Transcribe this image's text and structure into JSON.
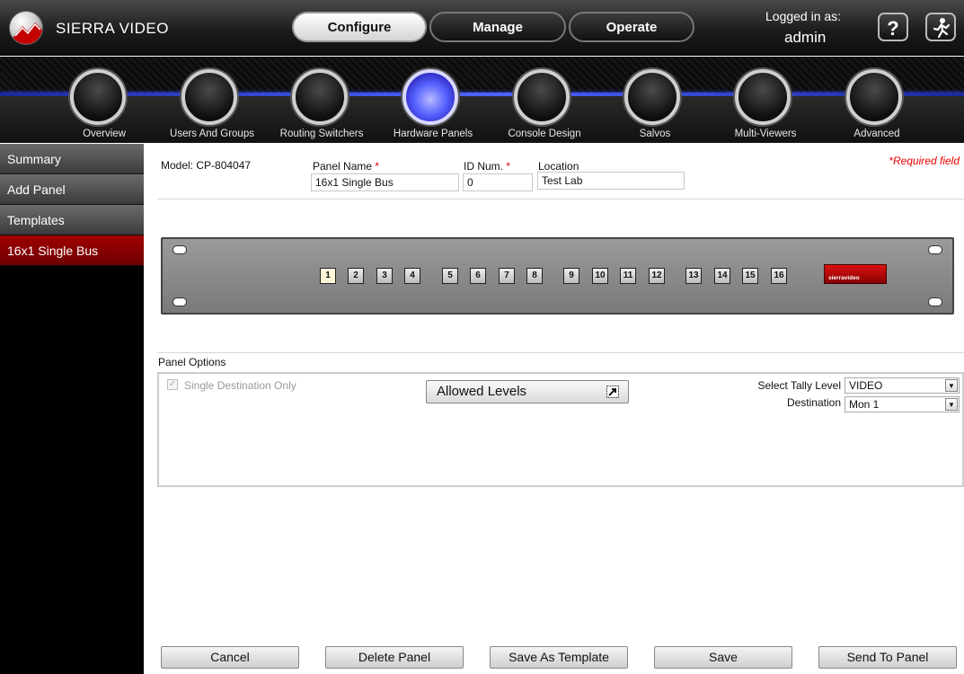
{
  "app": {
    "brand": "SIERRA VIDEO",
    "modes": [
      "Configure",
      "Manage",
      "Operate"
    ],
    "active_mode": "Configure",
    "login_label": "Logged in as:",
    "login_user": "admin"
  },
  "nav": {
    "items": [
      "Overview",
      "Users And Groups",
      "Routing Switchers",
      "Hardware Panels",
      "Console Design",
      "Salvos",
      "Multi-Viewers",
      "Advanced"
    ],
    "active": "Hardware Panels"
  },
  "sidebar": {
    "items": [
      "Summary",
      "Add Panel",
      "Templates",
      "16x1 Single Bus"
    ],
    "active": "16x1 Single Bus"
  },
  "form": {
    "model": "Model: CP-804047",
    "panel_name_label": "Panel Name",
    "panel_name_value": "16x1 Single Bus",
    "id_label": "ID Num.",
    "id_value": "0",
    "location_label": "Location",
    "location_value": "Test Lab",
    "required_marker": "*",
    "required_note": "*Required field"
  },
  "panel": {
    "buttons": [
      "1",
      "2",
      "3",
      "4",
      "5",
      "6",
      "7",
      "8",
      "9",
      "10",
      "11",
      "12",
      "13",
      "14",
      "15",
      "16"
    ],
    "logo_text": "sierravideo"
  },
  "options": {
    "title": "Panel Options",
    "single_destination_label": "Single Destination Only",
    "single_destination_checked": true,
    "allowed_levels_label": "Allowed Levels",
    "tally_label": "Select Tally Level",
    "tally_value": "VIDEO",
    "destination_label": "Destination",
    "destination_value": "Mon 1"
  },
  "actions": [
    "Cancel",
    "Delete Panel",
    "Save As Template",
    "Save",
    "Send To Panel"
  ],
  "colors": {
    "accent_red": "#8a0000",
    "nav_rail_blue": "#4d63ff",
    "required_red": "#e00000"
  }
}
